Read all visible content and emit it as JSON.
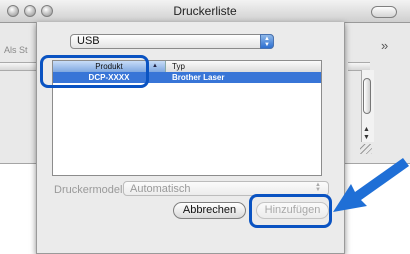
{
  "window": {
    "title": "Druckerliste",
    "overflow_glyph": "»",
    "bg_column_text": "Als St"
  },
  "connection": {
    "selected": "USB"
  },
  "table": {
    "columns": [
      "Produkt",
      "Typ"
    ],
    "sort_glyph": "▲",
    "rows": [
      {
        "product": "DCP-XXXX",
        "type": "Brother Laser",
        "selected": true
      }
    ]
  },
  "model": {
    "label": "Druckermodell:",
    "value": "Automatisch"
  },
  "buttons": {
    "cancel": "Abbrechen",
    "add": "Hinzufügen"
  },
  "colors": {
    "highlight": "#0a53c2",
    "arrow": "#1f6fd6",
    "selection": "#3875d7"
  }
}
